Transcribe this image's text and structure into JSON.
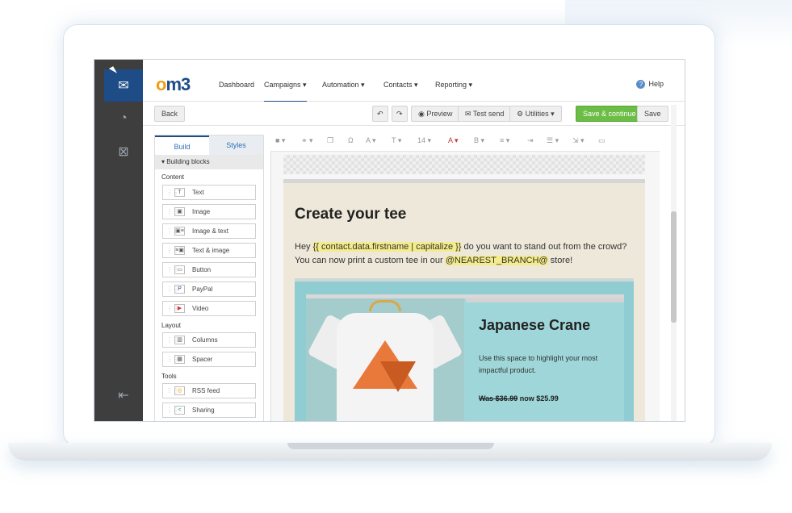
{
  "nav": {
    "logo": "om3",
    "items": [
      {
        "label": "Dashboard"
      },
      {
        "label": "Campaigns"
      },
      {
        "label": "Automation"
      },
      {
        "label": "Contacts"
      },
      {
        "label": "Reporting"
      }
    ],
    "help_label": "Help"
  },
  "toolbar": {
    "back_label": "Back",
    "preview_label": "Preview",
    "test_send_label": "Test send",
    "utilities_label": "Utilities",
    "save_continue_label": "Save & continue",
    "save_label": "Save"
  },
  "builder": {
    "tabs": [
      {
        "label": "Build"
      },
      {
        "label": "Styles"
      }
    ],
    "section_header": "Building blocks",
    "groups": {
      "content_label": "Content",
      "layout_label": "Layout",
      "tools_label": "Tools"
    },
    "content_blocks": [
      {
        "label": "Text",
        "icon": "text-icon"
      },
      {
        "label": "Image",
        "icon": "image-icon"
      },
      {
        "label": "Image & text",
        "icon": "image-text-icon"
      },
      {
        "label": "Text & image",
        "icon": "text-image-icon"
      },
      {
        "label": "Button",
        "icon": "button-icon"
      },
      {
        "label": "PayPal",
        "icon": "paypal-icon"
      },
      {
        "label": "Video",
        "icon": "video-icon"
      }
    ],
    "layout_blocks": [
      {
        "label": "Columns",
        "icon": "columns-icon"
      },
      {
        "label": "Spacer",
        "icon": "spacer-icon"
      }
    ],
    "tools_blocks": [
      {
        "label": "RSS feed",
        "icon": "rss-icon"
      },
      {
        "label": "Sharing",
        "icon": "share-icon"
      }
    ]
  },
  "editor": {
    "font_size": "14",
    "email": {
      "heading": "Create your tee",
      "line1_prefix": "Hey ",
      "line1_merge": "{{ contact.data.firstname | capitalize }}",
      "line1_suffix": " do you want to stand out from the crowd?",
      "line2_prefix": "You can now print a custom tee in our ",
      "line2_merge": "@NEAREST_BRANCH@",
      "line2_suffix": " store!",
      "product_title": "Japanese Crane",
      "product_desc": "Use this space to highlight your most impactful product.",
      "old_price": "Was $36.99",
      "new_price": " now $25.99"
    }
  },
  "colors": {
    "brand_blue": "#1d4c87",
    "accent_orange": "#f39c12",
    "save_green": "#6cbd45",
    "promo_teal": "#8fcdd2",
    "email_bg": "#ede8d9"
  }
}
